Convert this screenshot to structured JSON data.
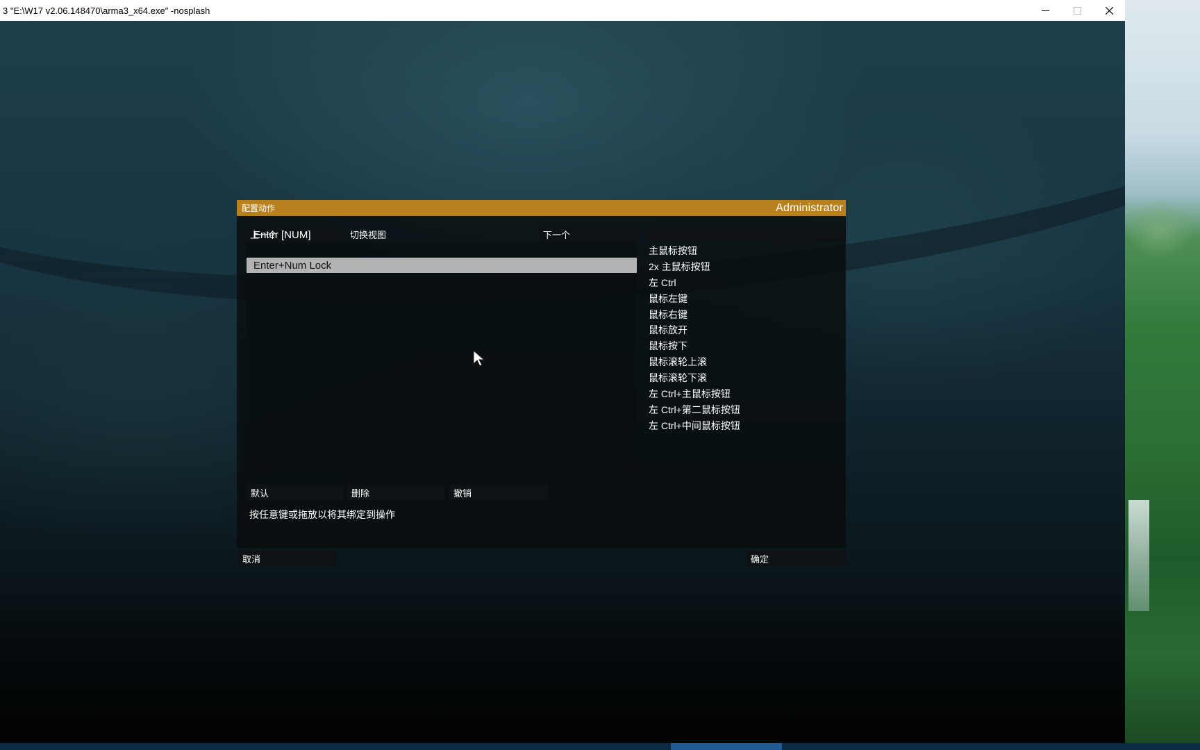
{
  "window": {
    "title": "3 \"E:\\W17 v2.06.148470\\arma3_x64.exe\" -nosplash"
  },
  "dialog": {
    "title": "配置动作",
    "user": "Administrator",
    "nav": {
      "prev_label": "上一个",
      "view_label": "切换视图",
      "next_label": "下一个"
    },
    "keys": [
      {
        "label": "Enter [NUM]",
        "selected": false
      },
      {
        "label": "Enter+Num Lock",
        "selected": true
      }
    ],
    "actions": [
      "主鼠标按钮",
      "2x 主鼠标按钮",
      "左 Ctrl",
      "鼠标左键",
      "鼠标右键",
      "鼠标放开",
      "鼠标按下",
      "鼠标滚轮上滚",
      "鼠标滚轮下滚",
      "左 Ctrl+主鼠标按钮",
      "左 Ctrl+第二鼠标按钮",
      "左 Ctrl+中间鼠标按钮"
    ],
    "buttons": {
      "default_label": "默认",
      "delete_label": "删除",
      "undo_label": "撤销",
      "cancel_label": "取消",
      "ok_label": "确定"
    },
    "hint": "按任意键或拖放以将其绑定到操作"
  },
  "colors": {
    "header": "#b8811e",
    "selected_row": "#b3b3b3"
  }
}
